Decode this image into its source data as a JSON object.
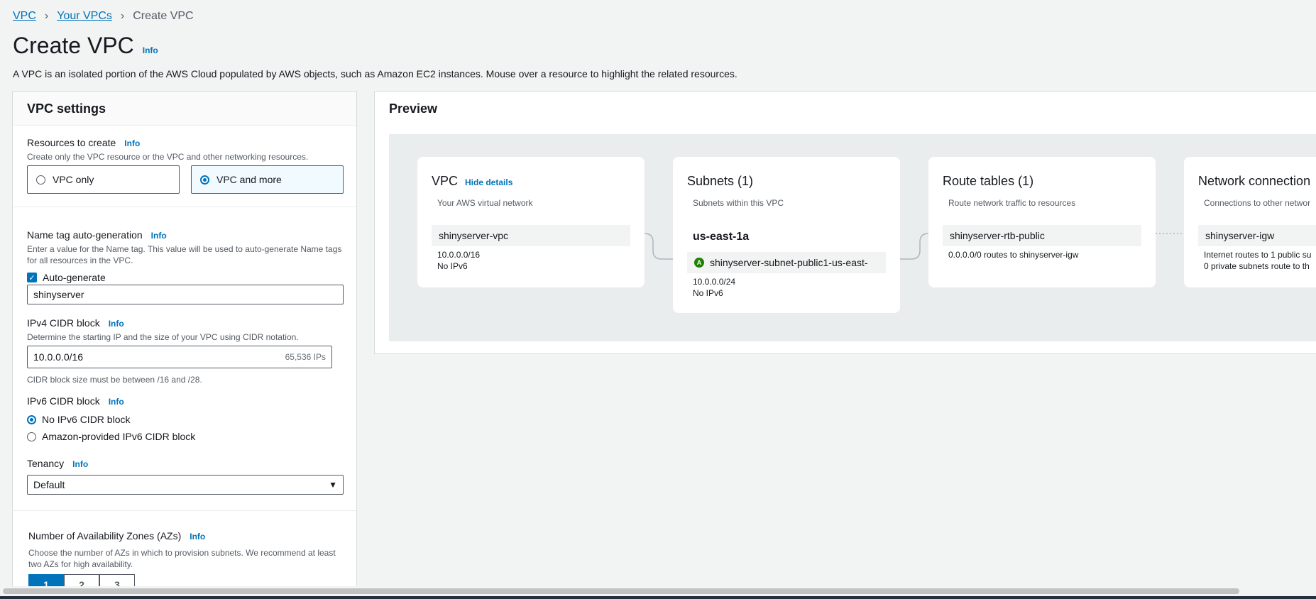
{
  "breadcrumb": {
    "vpc": "VPC",
    "your_vpcs": "Your VPCs",
    "current": "Create VPC"
  },
  "title": "Create VPC",
  "info": "Info",
  "description": "A VPC is an isolated portion of the AWS Cloud populated by AWS objects, such as Amazon EC2 instances. Mouse over a resource to highlight the related resources.",
  "settings": {
    "header": "VPC settings",
    "resources": {
      "label": "Resources to create",
      "desc": "Create only the VPC resource or the VPC and other networking resources.",
      "option_vpc_only": "VPC only",
      "option_vpc_and_more": "VPC and more"
    },
    "name_tag": {
      "label": "Name tag auto-generation",
      "desc": "Enter a value for the Name tag. This value will be used to auto-generate Name tags for all resources in the VPC.",
      "auto_generate": "Auto-generate",
      "value": "shinyserver"
    },
    "ipv4": {
      "label": "IPv4 CIDR block",
      "desc": "Determine the starting IP and the size of your VPC using CIDR notation.",
      "value": "10.0.0.0/16",
      "suffix": "65,536 IPs",
      "hint": "CIDR block size must be between /16 and /28."
    },
    "ipv6": {
      "label": "IPv6 CIDR block",
      "option_none": "No IPv6 CIDR block",
      "option_amazon": "Amazon-provided IPv6 CIDR block"
    },
    "tenancy": {
      "label": "Tenancy",
      "value": "Default"
    },
    "azs": {
      "label": "Number of Availability Zones (AZs)",
      "desc": "Choose the number of AZs in which to provision subnets. We recommend at least two AZs for high availability.",
      "options": [
        "1",
        "2",
        "3"
      ]
    }
  },
  "preview": {
    "header": "Preview",
    "vpc": {
      "title": "VPC",
      "hide": "Hide details",
      "sub": "Your AWS virtual network",
      "name": "shinyserver-vpc",
      "cidr": "10.0.0.0/16",
      "ipv6": "No IPv6"
    },
    "subnets": {
      "title": "Subnets (1)",
      "sub": "Subnets within this VPC",
      "az": "us-east-1a",
      "badge": "A",
      "name": "shinyserver-subnet-public1-us-east-",
      "cidr": "10.0.0.0/24",
      "ipv6": "No IPv6"
    },
    "routes": {
      "title": "Route tables (1)",
      "sub": "Route network traffic to resources",
      "name": "shinyserver-rtb-public",
      "detail": "0.0.0.0/0 routes to shinyserver-igw"
    },
    "network": {
      "title": "Network connection",
      "sub": "Connections to other networ",
      "name": "shinyserver-igw",
      "detail1": "Internet routes to 1 public su",
      "detail2": "0 private subnets route to th"
    }
  }
}
